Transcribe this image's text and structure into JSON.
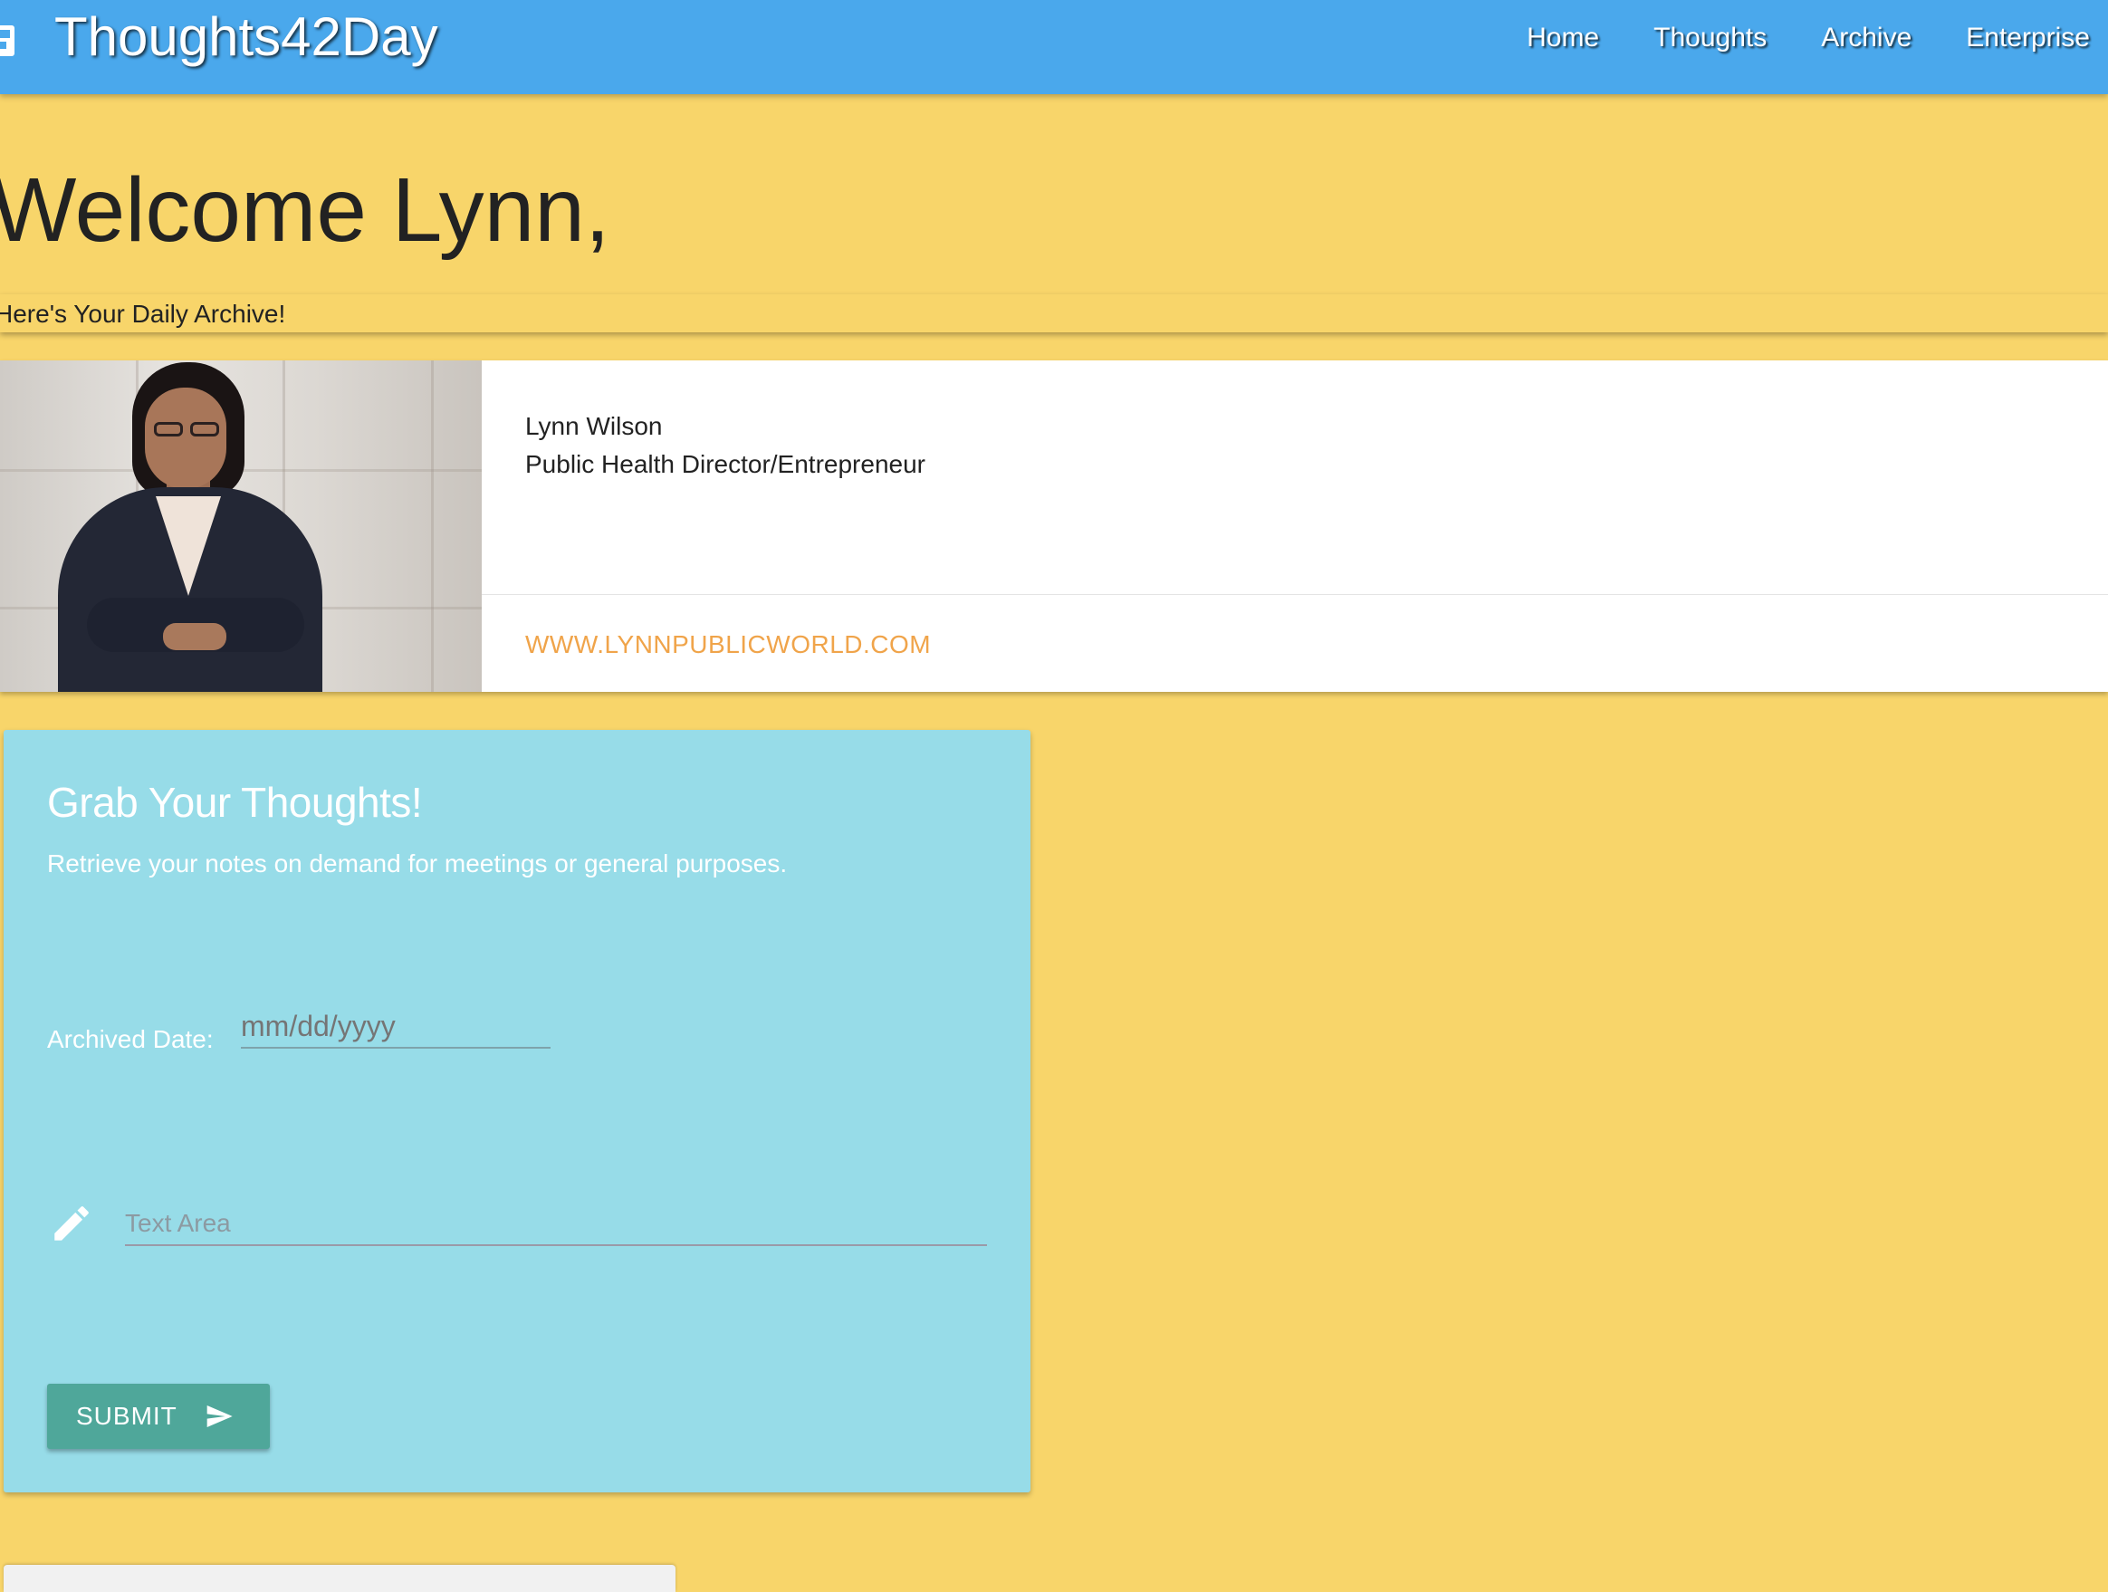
{
  "navbar": {
    "brand": "Thoughts42Day",
    "brand_icon": "calendar-icon",
    "links": [
      "Home",
      "Thoughts",
      "Archive",
      "Enterprise"
    ],
    "color": "#4aa8ec"
  },
  "header": {
    "welcome": "Welcome Lynn,",
    "subtitle": "Here's Your Daily Archive!"
  },
  "profile": {
    "name": "Lynn Wilson",
    "title": "Public Health Director/Entrepreneur",
    "link": "WWW.LYNNPUBLICWORLD.COM",
    "link_color": "#f0a44a"
  },
  "thoughts_form": {
    "title": "Grab Your Thoughts!",
    "description": "Retrieve your notes on demand for meetings or general purposes.",
    "date_label": "Archived Date:",
    "date_placeholder": "mm/dd/yyyy",
    "date_value": "",
    "text_placeholder": "Text Area",
    "text_icon": "pencil-icon",
    "submit_label": "SUBMIT",
    "submit_icon": "send-icon",
    "submit_color": "#4fa79a",
    "card_color": "#97dce8"
  },
  "theme": {
    "page_background": "#f8d56a"
  }
}
